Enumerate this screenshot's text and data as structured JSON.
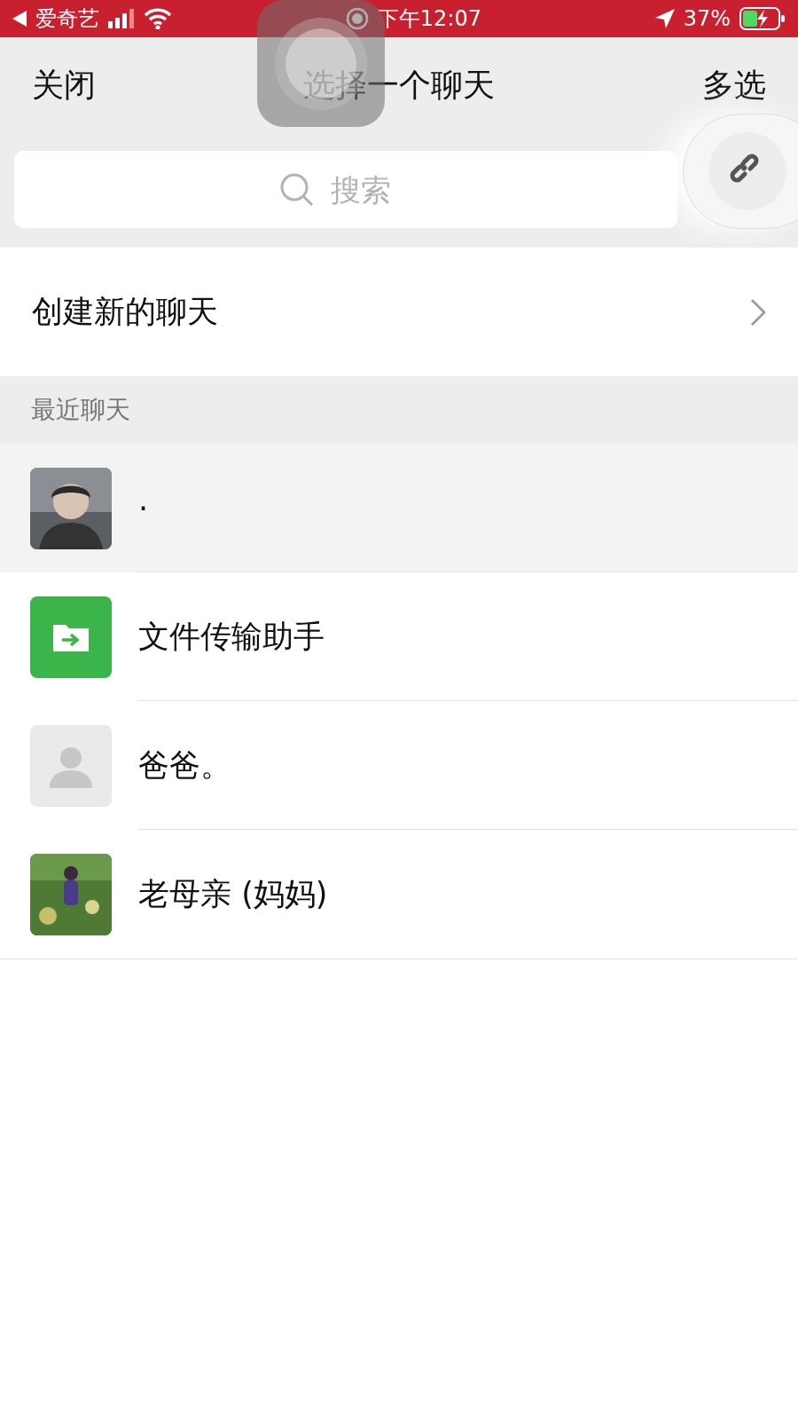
{
  "status_bar": {
    "back_app": "爱奇艺",
    "time": "下午12:07",
    "battery": "37%"
  },
  "nav": {
    "close": "关闭",
    "title": "选择一个聊天",
    "multi_select": "多选"
  },
  "search": {
    "placeholder": "搜索"
  },
  "create_chat": "创建新的聊天",
  "section": "最近聊天",
  "chats": [
    {
      "name": "·",
      "kind": "picture",
      "selected": true
    },
    {
      "name": "文件传输助手",
      "kind": "file",
      "selected": false
    },
    {
      "name": "爸爸。",
      "kind": "default",
      "selected": false
    },
    {
      "name": "老母亲 (妈妈)",
      "kind": "picture",
      "selected": false
    }
  ]
}
